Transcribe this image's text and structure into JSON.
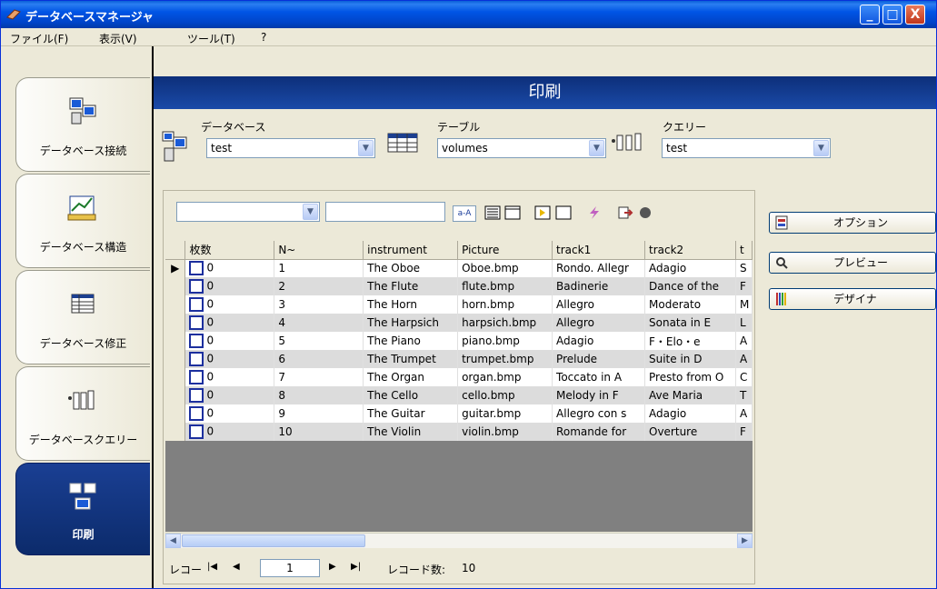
{
  "window": {
    "title": "データベースマネージャ",
    "controls": {
      "minimize": "_",
      "maximize": "□",
      "close": "X"
    }
  },
  "menu": [
    "ファイル(F)",
    "表示(V)",
    "ツール(T)",
    "?"
  ],
  "nav": [
    {
      "label": "データベース接続",
      "icon": "database-connect-icon"
    },
    {
      "label": "データベース構造",
      "icon": "database-structure-icon"
    },
    {
      "label": "データベース修正",
      "icon": "database-edit-icon"
    },
    {
      "label": "データベースクエリー",
      "icon": "database-query-icon"
    },
    {
      "label": "印刷",
      "icon": "print-icon",
      "active": true
    }
  ],
  "page_title": "印刷",
  "selectors": {
    "database": {
      "label": "データベース",
      "value": "test"
    },
    "table": {
      "label": "テーブル",
      "value": "volumes"
    },
    "query": {
      "label": "クエリー",
      "value": "test"
    }
  },
  "toolbar": {
    "filter_value": "",
    "search_value": "",
    "az_label": "a-A"
  },
  "grid": {
    "columns": [
      "枚数",
      "N~",
      "instrument",
      "Picture",
      "track1",
      "track2",
      "t"
    ],
    "rows": [
      [
        "0",
        "1",
        "The Oboe",
        "Oboe.bmp",
        "Rondo. Allegr",
        "Adagio",
        "S"
      ],
      [
        "0",
        "2",
        "The Flute",
        "flute.bmp",
        "Badinerie",
        "Dance of the",
        "F"
      ],
      [
        "0",
        "3",
        "The Horn",
        "horn.bmp",
        "Allegro",
        "Moderato",
        "M"
      ],
      [
        "0",
        "4",
        "The Harpsich",
        "harpsich.bmp",
        "Allegro",
        "Sonata in E",
        "L"
      ],
      [
        "0",
        "5",
        "The Piano",
        "piano.bmp",
        "Adagio",
        "F・Elo・e",
        "A"
      ],
      [
        "0",
        "6",
        "The Trumpet",
        "trumpet.bmp",
        "Prelude",
        "Suite in D",
        "A"
      ],
      [
        "0",
        "7",
        "The Organ",
        "organ.bmp",
        "Toccato in A",
        "Presto from O",
        "C"
      ],
      [
        "0",
        "8",
        "The Cello",
        "cello.bmp",
        "Melody in F",
        "Ave Maria",
        "T"
      ],
      [
        "0",
        "9",
        "The Guitar",
        "guitar.bmp",
        "Allegro con s",
        "Adagio",
        "A"
      ],
      [
        "0",
        "10",
        "The Violin",
        "violin.bmp",
        "Romande for",
        "Overture",
        "F"
      ]
    ]
  },
  "navigator": {
    "record_label": "レコー",
    "current": "1",
    "count_label": "レコード数:",
    "count": "10"
  },
  "side_buttons": [
    {
      "label": "オプション",
      "icon": "options-icon"
    },
    {
      "label": "プレビュー",
      "icon": "preview-icon"
    },
    {
      "label": "デザイナ",
      "icon": "designer-icon"
    }
  ]
}
